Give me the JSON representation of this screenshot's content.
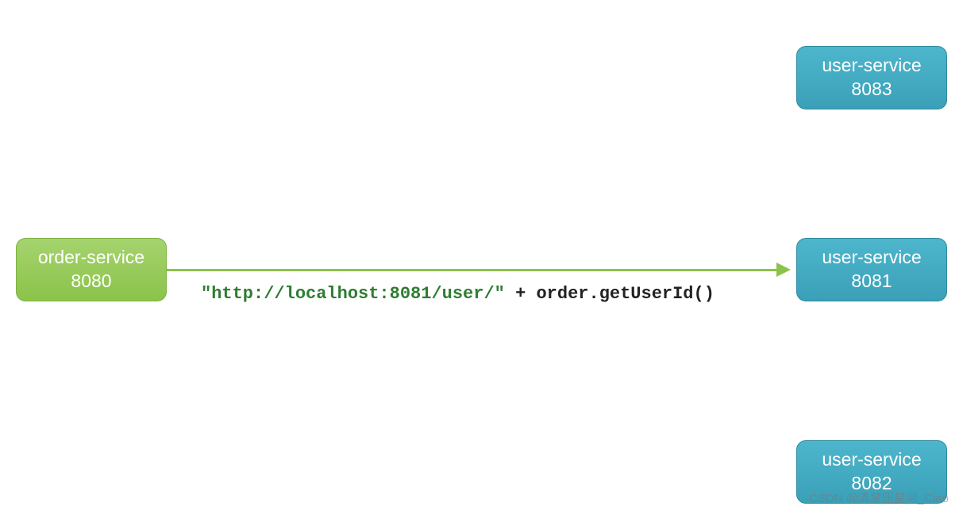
{
  "nodes": {
    "order": {
      "name": "order-service",
      "port": "8080"
    },
    "user1": {
      "name": "user-service",
      "port": "8083"
    },
    "user2": {
      "name": "user-service",
      "port": "8081"
    },
    "user3": {
      "name": "user-service",
      "port": "8082"
    }
  },
  "arrow": {
    "label_url": "\"http://localhost:8081/user/\"",
    "label_code": " + order.getUserId()"
  },
  "watermark": "CSDN @清梦压星河_Ciao",
  "colors": {
    "green_node": "#8bc34a",
    "teal_node": "#3aa0b8",
    "arrow": "#8bc34a",
    "label_green": "#2e7d32"
  }
}
